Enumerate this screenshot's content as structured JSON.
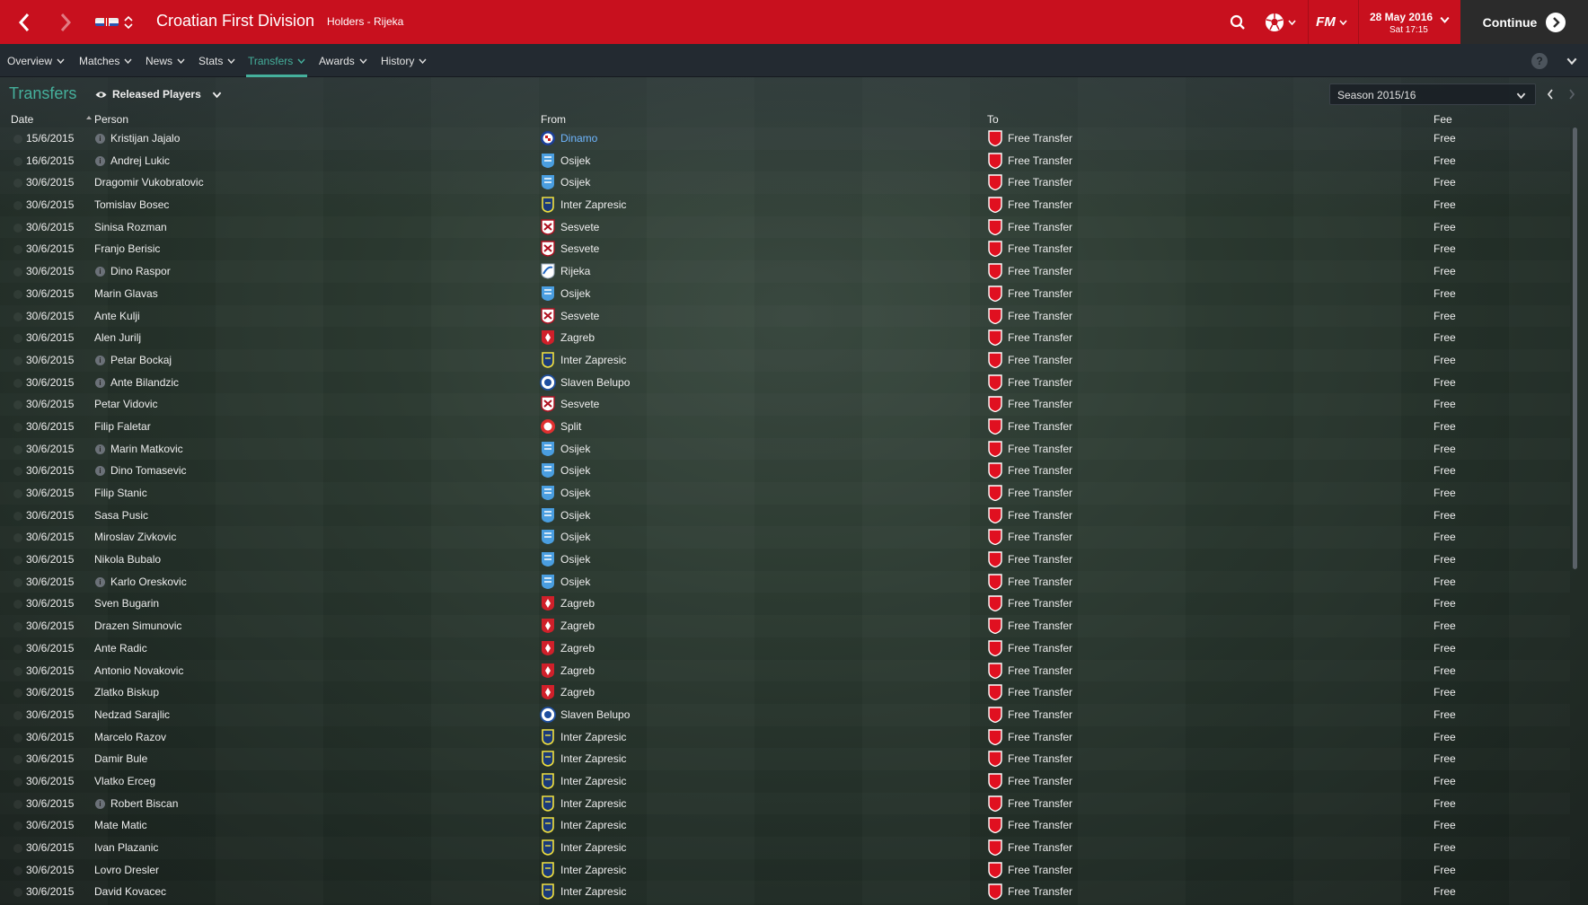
{
  "topbar": {
    "title": "Croatian First Division",
    "subtitle": "Holders - Rijeka",
    "date": "28 May 2016",
    "time": "Sat 17:15",
    "continue_label": "Continue",
    "fm_label": "FM",
    "accent_color": "#c8101e"
  },
  "menu": {
    "overview": "Overview",
    "matches": "Matches",
    "news": "News",
    "stats": "Stats",
    "transfers": "Transfers",
    "awards": "Awards",
    "history": "History",
    "help": "?"
  },
  "section": {
    "title": "Transfers",
    "view_label": "Released Players",
    "season_label": "Season 2015/16"
  },
  "table": {
    "headers": {
      "date": "Date",
      "person": "Person",
      "from": "From",
      "to": "To",
      "fee": "Fee"
    },
    "rows": [
      {
        "date": "15/6/2015",
        "person": "Kristijan Jajalo",
        "info": true,
        "from": "Dinamo",
        "crest": "dinamo",
        "link": true,
        "to": "Free Transfer",
        "fee": "Free"
      },
      {
        "date": "16/6/2015",
        "person": "Andrej Lukic",
        "info": true,
        "from": "Osijek",
        "crest": "osijek",
        "to": "Free Transfer",
        "fee": "Free"
      },
      {
        "date": "30/6/2015",
        "person": "Dragomir Vukobratovic",
        "info": false,
        "from": "Osijek",
        "crest": "osijek",
        "to": "Free Transfer",
        "fee": "Free"
      },
      {
        "date": "30/6/2015",
        "person": "Tomislav Bosec",
        "info": false,
        "from": "Inter Zapresic",
        "crest": "inter",
        "to": "Free Transfer",
        "fee": "Free"
      },
      {
        "date": "30/6/2015",
        "person": "Sinisa Rozman",
        "info": false,
        "from": "Sesvete",
        "crest": "sesvete",
        "to": "Free Transfer",
        "fee": "Free"
      },
      {
        "date": "30/6/2015",
        "person": "Franjo Berisic",
        "info": false,
        "from": "Sesvete",
        "crest": "sesvete",
        "to": "Free Transfer",
        "fee": "Free"
      },
      {
        "date": "30/6/2015",
        "person": "Dino Raspor",
        "info": true,
        "from": "Rijeka",
        "crest": "rijeka",
        "to": "Free Transfer",
        "fee": "Free"
      },
      {
        "date": "30/6/2015",
        "person": "Marin Glavas",
        "info": false,
        "from": "Osijek",
        "crest": "osijek",
        "to": "Free Transfer",
        "fee": "Free"
      },
      {
        "date": "30/6/2015",
        "person": "Ante Kulji",
        "info": false,
        "from": "Sesvete",
        "crest": "sesvete",
        "to": "Free Transfer",
        "fee": "Free"
      },
      {
        "date": "30/6/2015",
        "person": "Alen Jurilj",
        "info": false,
        "from": "Zagreb",
        "crest": "zagreb",
        "to": "Free Transfer",
        "fee": "Free"
      },
      {
        "date": "30/6/2015",
        "person": "Petar Bockaj",
        "info": true,
        "from": "Inter Zapresic",
        "crest": "inter",
        "to": "Free Transfer",
        "fee": "Free"
      },
      {
        "date": "30/6/2015",
        "person": "Ante Bilandzic",
        "info": true,
        "from": "Slaven Belupo",
        "crest": "slaven",
        "to": "Free Transfer",
        "fee": "Free"
      },
      {
        "date": "30/6/2015",
        "person": "Petar Vidovic",
        "info": false,
        "from": "Sesvete",
        "crest": "sesvete",
        "to": "Free Transfer",
        "fee": "Free"
      },
      {
        "date": "30/6/2015",
        "person": "Filip Faletar",
        "info": false,
        "from": "Split",
        "crest": "split",
        "to": "Free Transfer",
        "fee": "Free"
      },
      {
        "date": "30/6/2015",
        "person": "Marin Matkovic",
        "info": true,
        "from": "Osijek",
        "crest": "osijek",
        "to": "Free Transfer",
        "fee": "Free"
      },
      {
        "date": "30/6/2015",
        "person": "Dino Tomasevic",
        "info": true,
        "from": "Osijek",
        "crest": "osijek",
        "to": "Free Transfer",
        "fee": "Free"
      },
      {
        "date": "30/6/2015",
        "person": "Filip Stanic",
        "info": false,
        "from": "Osijek",
        "crest": "osijek",
        "to": "Free Transfer",
        "fee": "Free"
      },
      {
        "date": "30/6/2015",
        "person": "Sasa Pusic",
        "info": false,
        "from": "Osijek",
        "crest": "osijek",
        "to": "Free Transfer",
        "fee": "Free"
      },
      {
        "date": "30/6/2015",
        "person": "Miroslav Zivkovic",
        "info": false,
        "from": "Osijek",
        "crest": "osijek",
        "to": "Free Transfer",
        "fee": "Free"
      },
      {
        "date": "30/6/2015",
        "person": "Nikola Bubalo",
        "info": false,
        "from": "Osijek",
        "crest": "osijek",
        "to": "Free Transfer",
        "fee": "Free"
      },
      {
        "date": "30/6/2015",
        "person": "Karlo Oreskovic",
        "info": true,
        "from": "Osijek",
        "crest": "osijek",
        "to": "Free Transfer",
        "fee": "Free"
      },
      {
        "date": "30/6/2015",
        "person": "Sven Bugarin",
        "info": false,
        "from": "Zagreb",
        "crest": "zagreb",
        "to": "Free Transfer",
        "fee": "Free"
      },
      {
        "date": "30/6/2015",
        "person": "Drazen Simunovic",
        "info": false,
        "from": "Zagreb",
        "crest": "zagreb",
        "to": "Free Transfer",
        "fee": "Free"
      },
      {
        "date": "30/6/2015",
        "person": "Ante Radic",
        "info": false,
        "from": "Zagreb",
        "crest": "zagreb",
        "to": "Free Transfer",
        "fee": "Free"
      },
      {
        "date": "30/6/2015",
        "person": "Antonio Novakovic",
        "info": false,
        "from": "Zagreb",
        "crest": "zagreb",
        "to": "Free Transfer",
        "fee": "Free"
      },
      {
        "date": "30/6/2015",
        "person": "Zlatko Biskup",
        "info": false,
        "from": "Zagreb",
        "crest": "zagreb",
        "to": "Free Transfer",
        "fee": "Free"
      },
      {
        "date": "30/6/2015",
        "person": "Nedzad Sarajlic",
        "info": false,
        "from": "Slaven Belupo",
        "crest": "slaven",
        "to": "Free Transfer",
        "fee": "Free"
      },
      {
        "date": "30/6/2015",
        "person": "Marcelo Razov",
        "info": false,
        "from": "Inter Zapresic",
        "crest": "inter",
        "to": "Free Transfer",
        "fee": "Free"
      },
      {
        "date": "30/6/2015",
        "person": "Damir Bule",
        "info": false,
        "from": "Inter Zapresic",
        "crest": "inter",
        "to": "Free Transfer",
        "fee": "Free"
      },
      {
        "date": "30/6/2015",
        "person": "Vlatko Erceg",
        "info": false,
        "from": "Inter Zapresic",
        "crest": "inter",
        "to": "Free Transfer",
        "fee": "Free"
      },
      {
        "date": "30/6/2015",
        "person": "Robert Biscan",
        "info": true,
        "from": "Inter Zapresic",
        "crest": "inter",
        "to": "Free Transfer",
        "fee": "Free"
      },
      {
        "date": "30/6/2015",
        "person": "Mate Matic",
        "info": false,
        "from": "Inter Zapresic",
        "crest": "inter",
        "to": "Free Transfer",
        "fee": "Free"
      },
      {
        "date": "30/6/2015",
        "person": "Ivan Plazanic",
        "info": false,
        "from": "Inter Zapresic",
        "crest": "inter",
        "to": "Free Transfer",
        "fee": "Free"
      },
      {
        "date": "30/6/2015",
        "person": "Lovro Dresler",
        "info": false,
        "from": "Inter Zapresic",
        "crest": "inter",
        "to": "Free Transfer",
        "fee": "Free"
      },
      {
        "date": "30/6/2015",
        "person": "David Kovacec",
        "info": false,
        "from": "Inter Zapresic",
        "crest": "inter",
        "to": "Free Transfer",
        "fee": "Free"
      }
    ]
  }
}
